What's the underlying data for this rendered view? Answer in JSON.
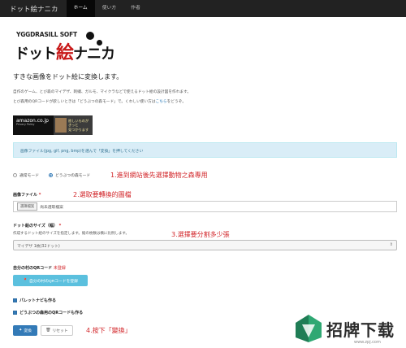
{
  "nav": {
    "brand": "ドット絵ナニカ",
    "items": [
      {
        "label": "ホーム",
        "active": true
      },
      {
        "label": "使い方",
        "active": false
      },
      {
        "label": "作者",
        "active": false
      }
    ]
  },
  "logo": {
    "publisher": "YGGDRASILL SOFT",
    "title_a": "ドット",
    "title_b": "絵",
    "title_c": "ナニカ"
  },
  "intro": {
    "lead": "すきな画像をドット絵に変換します。",
    "p1": "自作のゲーム、とび森のマイデザ、刺繍、ガルモ、マイクラなどで使えるドット絵の設計図を作れます。",
    "p2_pre": "とび森用のQRコードが欲しいときは「どうぶつの森モード」で。くわしい使い方は",
    "p2_link": "こちら",
    "p2_post": "をどうぞ。"
  },
  "ads": {
    "amazon_main": "amazon.co.jp",
    "amazon_sub": "Privacy Policy",
    "badge_text": [
      "欲しいものが",
      "きっと",
      "見つかります"
    ]
  },
  "alert_text": "画像ファイル(jpg, gif, png, bmp)を選んで「変換」を押してください",
  "mode": {
    "option1": "通常モード",
    "option2": "どうぶつの森モード",
    "selected": "option2"
  },
  "annotations": {
    "a1": "1.進到網站後先選擇動物之森專用",
    "a2": "2.選取要轉換的圖檔",
    "a3": "3.選擇要分割多少張",
    "a4": "4.按下「變換」"
  },
  "file": {
    "label": "画像ファイル",
    "required": "*",
    "button": "選擇檔案",
    "status": "尚未選取檔案"
  },
  "size": {
    "label": "ドット絵のサイズ（幅）",
    "required": "*",
    "help": "作成するドット絵のサイズを指定します。縦の枚数は横に比例します。",
    "selected": "マイデザ 1枚(32ドット)"
  },
  "qr": {
    "label": "自分の村のQRコード",
    "warn": "未登録",
    "button": "自分の村のQRコードを登録"
  },
  "checks": {
    "c1": "パレットナビも作る",
    "c2": "どうぶつの森用のQRコードも作る"
  },
  "buttons": {
    "convert": "変換",
    "reset": "リセット"
  },
  "watermark": {
    "text": "招牌下载",
    "url": "www.zpj.com"
  },
  "colors": {
    "primary": "#337ab7",
    "info": "#5bc0de",
    "annotation": "#d2262a",
    "navbar": "#222222"
  }
}
